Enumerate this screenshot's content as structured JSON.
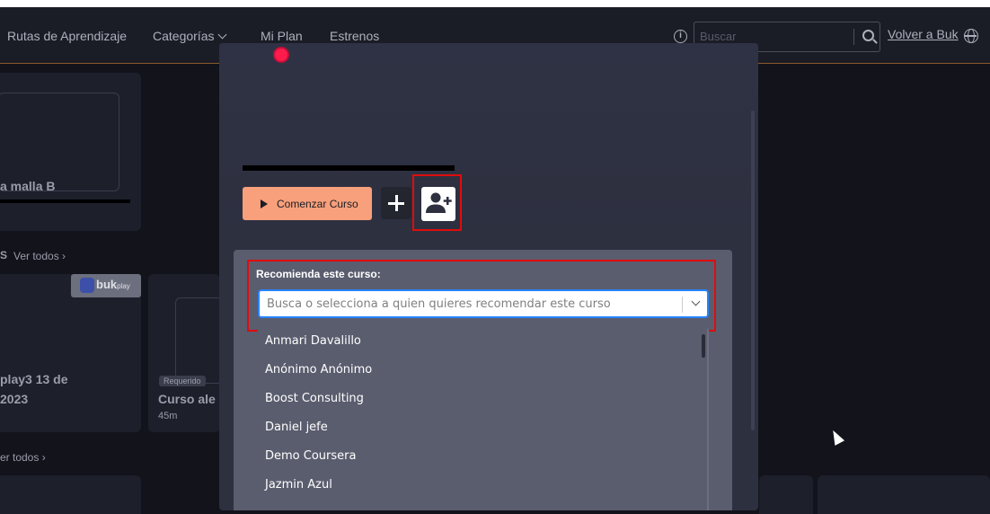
{
  "nav": {
    "items": [
      {
        "label": "Rutas de Aprendizaje"
      },
      {
        "label": "Categorías"
      },
      {
        "label": "Mi Plan"
      },
      {
        "label": "Estrenos"
      }
    ],
    "search": {
      "placeholder": "Buscar"
    },
    "volver_label": "Volver a Buk"
  },
  "background": {
    "card1_title": "a malla B",
    "section1_link": "Ver todos ›",
    "section1_prefix": "S",
    "card2_title_line1": "play3 13 de",
    "card2_title_line2": "2023",
    "bukplay_badge": "buk",
    "bukplay_badge_small": "play",
    "card3_badge": "Requerido",
    "card3_title": "Curso ale",
    "card3_duration": "45m",
    "section2_link": "er todos ›"
  },
  "modal": {
    "start_button_label": "Comenzar Curso",
    "recommend": {
      "title": "Recomienda este curso:",
      "placeholder": "Busca o selecciona a quien quieres recomendar este curso",
      "options": [
        "Anmari Davalillo",
        "Anónimo Anónimo",
        "Boost Consulting",
        "Daniel jefe",
        "Demo Coursera",
        "Jazmin Azul"
      ]
    }
  },
  "colors": {
    "accent_orange": "#f7a07b",
    "highlight_red": "#e00c0c",
    "record_dot": "#ff1b4b",
    "select_focus": "#2684ff"
  }
}
